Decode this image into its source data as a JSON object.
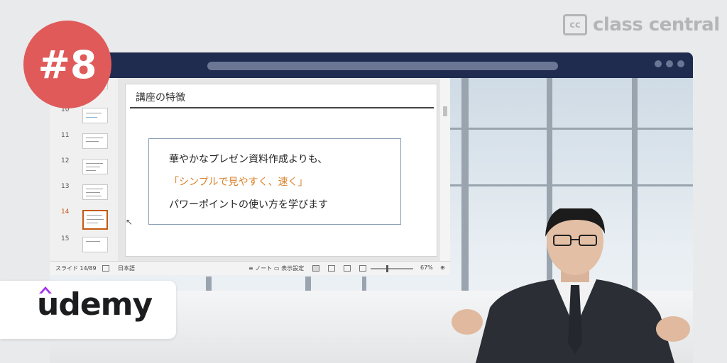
{
  "brand": {
    "cc_icon": "cc",
    "name": "class central"
  },
  "badge": {
    "text": "#8"
  },
  "window": {
    "controls": [
      "dot",
      "dot",
      "dot"
    ]
  },
  "ppt": {
    "thumbnails": [
      {
        "number": "",
        "active": false
      },
      {
        "number": "10",
        "active": false
      },
      {
        "number": "11",
        "active": false
      },
      {
        "number": "12",
        "active": false
      },
      {
        "number": "13",
        "active": false
      },
      {
        "number": "14",
        "active": true
      },
      {
        "number": "15",
        "active": false
      }
    ],
    "slide": {
      "title": "講座の特徴",
      "line1": "華やかなプレゼン資料作成よりも、",
      "line2": "「シンプルで見やすく、速く」",
      "line3": "パワーポイントの使い方を学びます"
    },
    "status": {
      "slide_counter": "スライド 14/89",
      "language": "日本語",
      "notes": "ノート",
      "display_settings": "表示設定",
      "zoom": "67%"
    }
  },
  "udemy": {
    "logo_text": "udemy"
  },
  "colors": {
    "badge": "#e05a5a",
    "titlebar": "#1f2b4f",
    "accent": "#d9822b",
    "active_thumb": "#c55a11"
  }
}
